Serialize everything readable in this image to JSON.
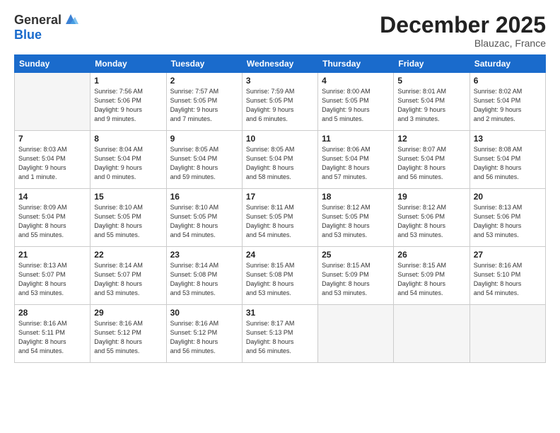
{
  "header": {
    "logo_general": "General",
    "logo_blue": "Blue",
    "month_title": "December 2025",
    "location": "Blauzac, France"
  },
  "days_of_week": [
    "Sunday",
    "Monday",
    "Tuesday",
    "Wednesday",
    "Thursday",
    "Friday",
    "Saturday"
  ],
  "weeks": [
    [
      {
        "day": "",
        "info": ""
      },
      {
        "day": "1",
        "info": "Sunrise: 7:56 AM\nSunset: 5:06 PM\nDaylight: 9 hours\nand 9 minutes."
      },
      {
        "day": "2",
        "info": "Sunrise: 7:57 AM\nSunset: 5:05 PM\nDaylight: 9 hours\nand 7 minutes."
      },
      {
        "day": "3",
        "info": "Sunrise: 7:59 AM\nSunset: 5:05 PM\nDaylight: 9 hours\nand 6 minutes."
      },
      {
        "day": "4",
        "info": "Sunrise: 8:00 AM\nSunset: 5:05 PM\nDaylight: 9 hours\nand 5 minutes."
      },
      {
        "day": "5",
        "info": "Sunrise: 8:01 AM\nSunset: 5:04 PM\nDaylight: 9 hours\nand 3 minutes."
      },
      {
        "day": "6",
        "info": "Sunrise: 8:02 AM\nSunset: 5:04 PM\nDaylight: 9 hours\nand 2 minutes."
      }
    ],
    [
      {
        "day": "7",
        "info": "Sunrise: 8:03 AM\nSunset: 5:04 PM\nDaylight: 9 hours\nand 1 minute."
      },
      {
        "day": "8",
        "info": "Sunrise: 8:04 AM\nSunset: 5:04 PM\nDaylight: 9 hours\nand 0 minutes."
      },
      {
        "day": "9",
        "info": "Sunrise: 8:05 AM\nSunset: 5:04 PM\nDaylight: 8 hours\nand 59 minutes."
      },
      {
        "day": "10",
        "info": "Sunrise: 8:05 AM\nSunset: 5:04 PM\nDaylight: 8 hours\nand 58 minutes."
      },
      {
        "day": "11",
        "info": "Sunrise: 8:06 AM\nSunset: 5:04 PM\nDaylight: 8 hours\nand 57 minutes."
      },
      {
        "day": "12",
        "info": "Sunrise: 8:07 AM\nSunset: 5:04 PM\nDaylight: 8 hours\nand 56 minutes."
      },
      {
        "day": "13",
        "info": "Sunrise: 8:08 AM\nSunset: 5:04 PM\nDaylight: 8 hours\nand 56 minutes."
      }
    ],
    [
      {
        "day": "14",
        "info": "Sunrise: 8:09 AM\nSunset: 5:04 PM\nDaylight: 8 hours\nand 55 minutes."
      },
      {
        "day": "15",
        "info": "Sunrise: 8:10 AM\nSunset: 5:05 PM\nDaylight: 8 hours\nand 55 minutes."
      },
      {
        "day": "16",
        "info": "Sunrise: 8:10 AM\nSunset: 5:05 PM\nDaylight: 8 hours\nand 54 minutes."
      },
      {
        "day": "17",
        "info": "Sunrise: 8:11 AM\nSunset: 5:05 PM\nDaylight: 8 hours\nand 54 minutes."
      },
      {
        "day": "18",
        "info": "Sunrise: 8:12 AM\nSunset: 5:05 PM\nDaylight: 8 hours\nand 53 minutes."
      },
      {
        "day": "19",
        "info": "Sunrise: 8:12 AM\nSunset: 5:06 PM\nDaylight: 8 hours\nand 53 minutes."
      },
      {
        "day": "20",
        "info": "Sunrise: 8:13 AM\nSunset: 5:06 PM\nDaylight: 8 hours\nand 53 minutes."
      }
    ],
    [
      {
        "day": "21",
        "info": "Sunrise: 8:13 AM\nSunset: 5:07 PM\nDaylight: 8 hours\nand 53 minutes."
      },
      {
        "day": "22",
        "info": "Sunrise: 8:14 AM\nSunset: 5:07 PM\nDaylight: 8 hours\nand 53 minutes."
      },
      {
        "day": "23",
        "info": "Sunrise: 8:14 AM\nSunset: 5:08 PM\nDaylight: 8 hours\nand 53 minutes."
      },
      {
        "day": "24",
        "info": "Sunrise: 8:15 AM\nSunset: 5:08 PM\nDaylight: 8 hours\nand 53 minutes."
      },
      {
        "day": "25",
        "info": "Sunrise: 8:15 AM\nSunset: 5:09 PM\nDaylight: 8 hours\nand 53 minutes."
      },
      {
        "day": "26",
        "info": "Sunrise: 8:15 AM\nSunset: 5:09 PM\nDaylight: 8 hours\nand 54 minutes."
      },
      {
        "day": "27",
        "info": "Sunrise: 8:16 AM\nSunset: 5:10 PM\nDaylight: 8 hours\nand 54 minutes."
      }
    ],
    [
      {
        "day": "28",
        "info": "Sunrise: 8:16 AM\nSunset: 5:11 PM\nDaylight: 8 hours\nand 54 minutes."
      },
      {
        "day": "29",
        "info": "Sunrise: 8:16 AM\nSunset: 5:12 PM\nDaylight: 8 hours\nand 55 minutes."
      },
      {
        "day": "30",
        "info": "Sunrise: 8:16 AM\nSunset: 5:12 PM\nDaylight: 8 hours\nand 56 minutes."
      },
      {
        "day": "31",
        "info": "Sunrise: 8:17 AM\nSunset: 5:13 PM\nDaylight: 8 hours\nand 56 minutes."
      },
      {
        "day": "",
        "info": ""
      },
      {
        "day": "",
        "info": ""
      },
      {
        "day": "",
        "info": ""
      }
    ]
  ]
}
